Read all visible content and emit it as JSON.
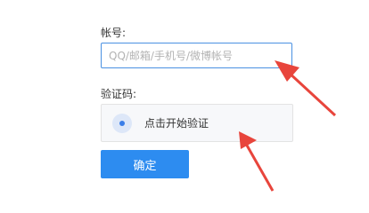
{
  "form": {
    "account_label": "帐号:",
    "account_placeholder": "QQ/邮箱/手机号/微博帐号",
    "account_value": "",
    "captcha_label": "验证码:",
    "captcha_prompt": "点击开始验证",
    "confirm_label": "确定"
  },
  "colors": {
    "input_focus_border": "#4a90e2",
    "button_background": "#2d8cf0",
    "captcha_dot": "#3a7ee8",
    "annotation_arrow": "#e8453c"
  },
  "icons": {
    "captcha_indicator": "radio-dot-icon",
    "annotation_arrow": "arrow-icon"
  }
}
